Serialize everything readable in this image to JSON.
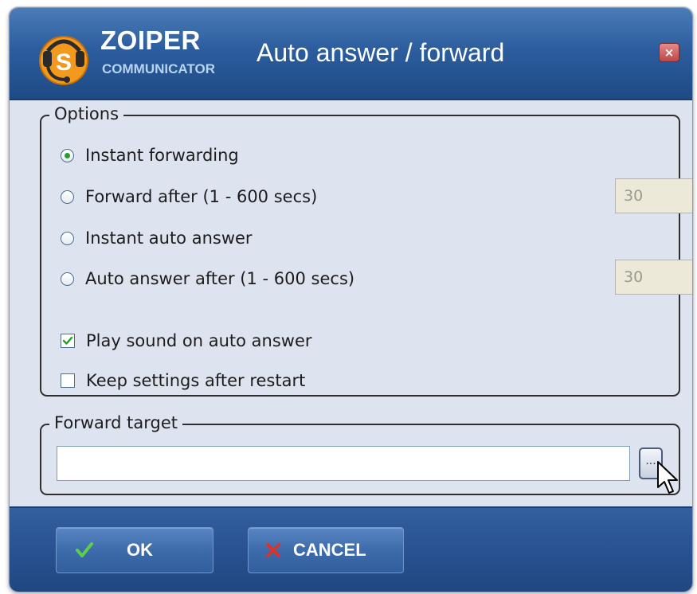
{
  "window": {
    "brand": "ZOIPER",
    "brand_sub": "COMMUNICATOR",
    "title": "Auto answer / forward",
    "close_label": "×"
  },
  "options": {
    "legend": "Options",
    "items": [
      {
        "label": "Instant forwarding",
        "type": "radio",
        "checked": true
      },
      {
        "label": "Forward after (1 - 600 secs)",
        "type": "radio",
        "checked": false,
        "value": "30"
      },
      {
        "label": "Instant auto answer",
        "type": "radio",
        "checked": false
      },
      {
        "label": "Auto answer after (1 - 600 secs)",
        "type": "radio",
        "checked": false,
        "value": "30"
      },
      {
        "label": "Play sound on auto answer",
        "type": "checkbox",
        "checked": true
      },
      {
        "label": "Keep settings after restart",
        "type": "checkbox",
        "checked": false
      }
    ]
  },
  "forward_target": {
    "legend": "Forward target",
    "value": "",
    "browse_label": "..."
  },
  "buttons": {
    "ok": "OK",
    "cancel": "CANCEL"
  },
  "colors": {
    "title_bar": "#2c5d9e",
    "body": "#dde3ef",
    "ok_check": "#5bd14a",
    "cancel_x": "#d8342b"
  },
  "icons": [
    "zoiper-logo-icon",
    "close-icon",
    "radio-selected-icon",
    "checkbox-checked-icon",
    "check-icon",
    "x-icon",
    "mouse-cursor-icon"
  ]
}
